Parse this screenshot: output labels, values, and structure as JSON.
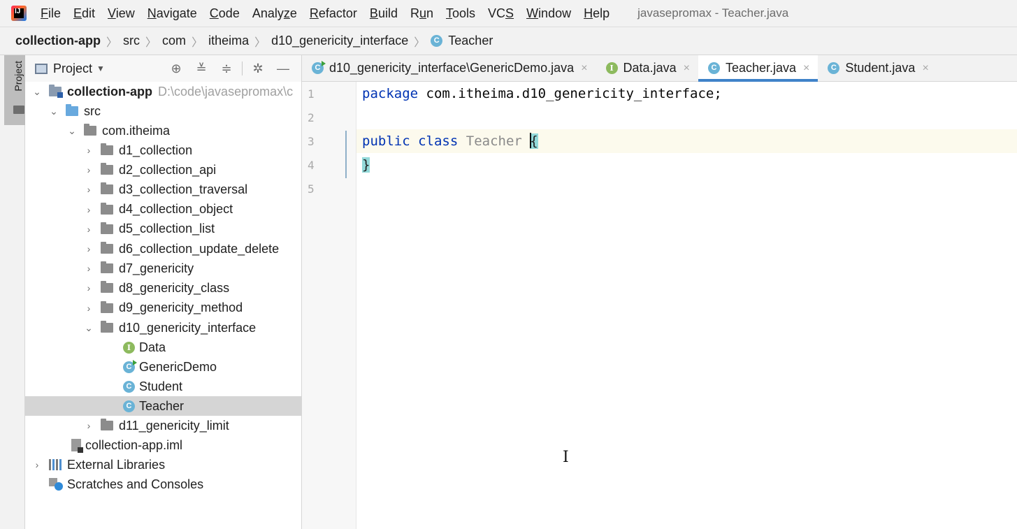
{
  "menu": {
    "items": [
      {
        "label": "File",
        "mn": "F",
        "rest": "ile"
      },
      {
        "label": "Edit",
        "mn": "E",
        "rest": "dit"
      },
      {
        "label": "View",
        "mn": "V",
        "rest": "iew"
      },
      {
        "label": "Navigate",
        "mn": "N",
        "rest": "avigate"
      },
      {
        "label": "Code",
        "mn": "C",
        "rest": "ode"
      },
      {
        "label": "Analyze",
        "pre": "Analy",
        "mn": "z",
        "rest": "e"
      },
      {
        "label": "Refactor",
        "mn": "R",
        "rest": "efactor"
      },
      {
        "label": "Build",
        "mn": "B",
        "rest": "uild"
      },
      {
        "label": "Run",
        "pre": "R",
        "mn": "u",
        "rest": "n"
      },
      {
        "label": "Tools",
        "mn": "T",
        "rest": "ools"
      },
      {
        "label": "VCS",
        "pre": "VC",
        "mn": "S",
        "rest": ""
      },
      {
        "label": "Window",
        "mn": "W",
        "rest": "indow"
      },
      {
        "label": "Help",
        "mn": "H",
        "rest": "elp"
      }
    ],
    "window_title": "javasepromax - Teacher.java"
  },
  "breadcrumb": {
    "items": [
      "collection-app",
      "src",
      "com",
      "itheima",
      "d10_genericity_interface",
      "Teacher"
    ],
    "separator": "〉",
    "class_badge": "C"
  },
  "stripe": {
    "project_tab": "Project"
  },
  "project_panel": {
    "title": "Project",
    "dropdown_icon": "chevron-down-icon",
    "tools": [
      "locate-icon",
      "collapse-all-icon",
      "expand-all-icon",
      "gear-icon",
      "minimize-icon"
    ],
    "tools_glyphs": [
      "⊕",
      "≚",
      "≑",
      "✲",
      "—"
    ],
    "root_label": "collection-app",
    "root_path": "D:\\code\\javasepromax\\c",
    "src_label": "src",
    "pkg_label": "com.itheima",
    "packages": [
      "d1_collection",
      "d2_collection_api",
      "d3_collection_traversal",
      "d4_collection_object",
      "d5_collection_list",
      "d6_collection_update_delete",
      "d7_genericity",
      "d8_genericity_class",
      "d9_genericity_method"
    ],
    "open_package": "d10_genericity_interface",
    "files": {
      "data": "Data",
      "generic_demo": "GenericDemo",
      "student": "Student",
      "teacher": "Teacher"
    },
    "after_package": "d11_genericity_limit",
    "iml": "collection-app.iml",
    "external_libs": "External Libraries",
    "scratches": "Scratches and Consoles",
    "iface_badge": "I",
    "class_badge": "C"
  },
  "tabs": [
    {
      "label": "d10_genericity_interface\\GenericDemo.java",
      "badge": "C",
      "kind": "class-run",
      "active": false
    },
    {
      "label": "Data.java",
      "badge": "I",
      "kind": "interface",
      "active": false
    },
    {
      "label": "Teacher.java",
      "badge": "C",
      "kind": "class",
      "active": true
    },
    {
      "label": "Student.java",
      "badge": "C",
      "kind": "class",
      "active": false
    }
  ],
  "tab_close": "×",
  "editor": {
    "line_numbers": [
      "1",
      "2",
      "3",
      "4",
      "5"
    ],
    "line1_kw": "package",
    "line1_rest": " com.itheima.d10_genericity_interface;",
    "line3_kw1": "public",
    "line3_kw2": "class",
    "line3_name": "Teacher",
    "open_brace": "{",
    "close_brace": "}",
    "cursor": "I"
  }
}
